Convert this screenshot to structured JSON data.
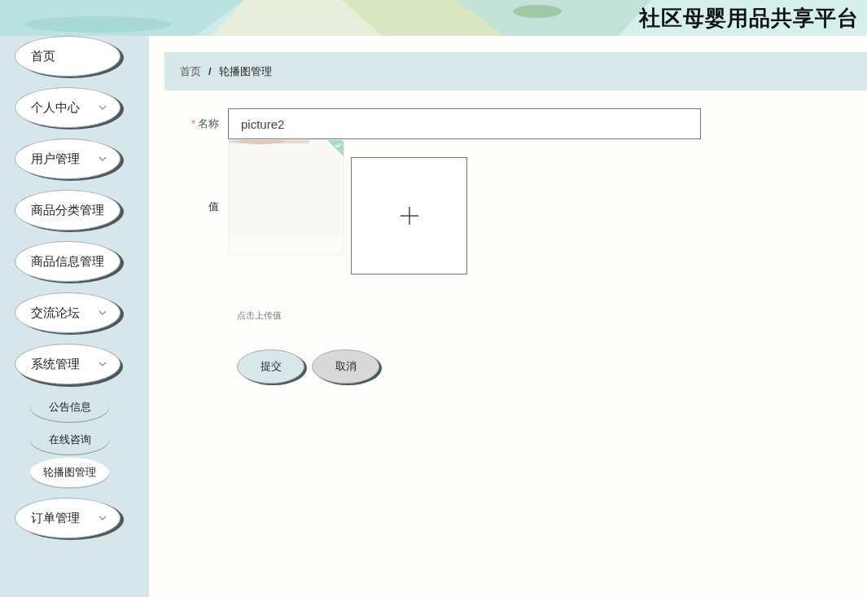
{
  "header": {
    "title": "社区母婴用品共享平台"
  },
  "sidebar": {
    "items": [
      {
        "label": "首页",
        "has_arrow": false,
        "expanded": false
      },
      {
        "label": "个人中心",
        "has_arrow": true,
        "expanded": false
      },
      {
        "label": "用户管理",
        "has_arrow": true,
        "expanded": false
      },
      {
        "label": "商品分类管理",
        "has_arrow": false,
        "expanded": false
      },
      {
        "label": "商品信息管理",
        "has_arrow": false,
        "expanded": false
      },
      {
        "label": "交流论坛",
        "has_arrow": true,
        "expanded": false
      },
      {
        "label": "系统管理",
        "has_arrow": true,
        "expanded": true,
        "children": [
          {
            "label": "公告信息",
            "selected": false
          },
          {
            "label": "在线咨询",
            "selected": false
          },
          {
            "label": "轮播图管理",
            "selected": true
          }
        ]
      },
      {
        "label": "订单管理",
        "has_arrow": true,
        "expanded": false
      }
    ]
  },
  "breadcrumb": {
    "separator": "/",
    "items": [
      "首页",
      "轮播图管理"
    ]
  },
  "form": {
    "name_field": {
      "label": "名称",
      "required_mark": "*",
      "value": "picture2"
    },
    "value_field": {
      "label": "值",
      "hint": "点击上传值"
    },
    "buttons": [
      {
        "label": "提交",
        "kind": "primary"
      },
      {
        "label": "取消",
        "kind": "secondary"
      }
    ]
  }
}
